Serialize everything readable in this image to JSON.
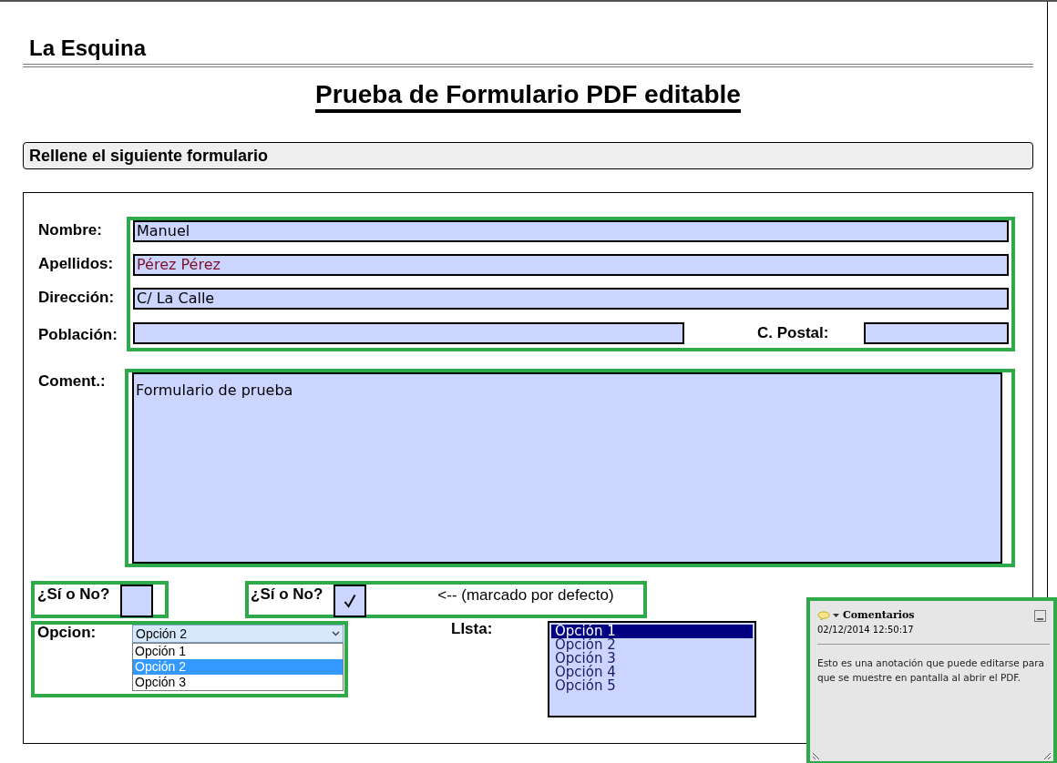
{
  "header": {
    "site_name": "La Esquina"
  },
  "title": "Prueba de Formulario PDF editable",
  "section_heading": "Rellene el siguiente formulario",
  "fields": [
    {
      "label": "Nombre:",
      "value": "Manuel"
    },
    {
      "label": "Apellidos:",
      "value": "Pérez Pérez",
      "color": "#7a1028"
    },
    {
      "label": "Dirección:",
      "value": "C/ La Calle"
    }
  ],
  "town": {
    "label": "Población:"
  },
  "postal_code": {
    "label": "C. Postal:"
  },
  "comment_field": {
    "label": "Coment.:",
    "value": "Formulario de prueba"
  },
  "checkboxes": [
    {
      "label": "¿Sí o No?",
      "checked": false
    },
    {
      "label": "¿Sí o No?",
      "checked": true,
      "note": "<-- (marcado por defecto)"
    }
  ],
  "dropdown": {
    "label": "Opcion:",
    "value": "Opción 2",
    "expanded": true,
    "options": [
      {
        "label": "Opción 1",
        "selected": false
      },
      {
        "label": "Opción 2",
        "selected": true
      },
      {
        "label": "Opción 3",
        "selected": false
      }
    ]
  },
  "listbox": {
    "label": "LIsta:",
    "options": [
      {
        "label": "Opción 1",
        "selected": true
      },
      {
        "label": "Opción 2",
        "selected": false
      },
      {
        "label": "Opción 3",
        "selected": false
      },
      {
        "label": "Opción 4",
        "selected": false
      },
      {
        "label": "Opción 5",
        "selected": false
      }
    ]
  },
  "annotation": {
    "title": "Comentarios",
    "date": "02/12/2014 12:50:17",
    "text": "Esto es una anotación que puede editarse para que se muestre en pantalla al abrir el PDF."
  }
}
